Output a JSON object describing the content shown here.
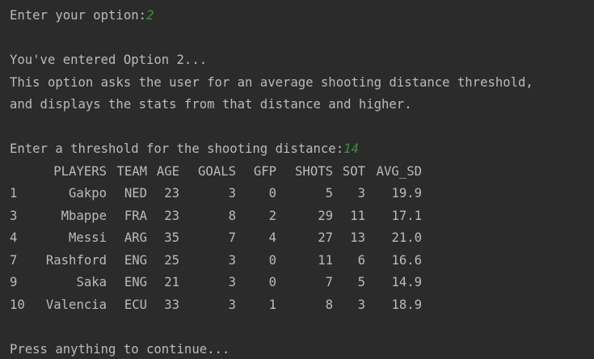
{
  "prompt": {
    "label": "Enter your option:",
    "value": "2"
  },
  "messages": {
    "entered": "You've entered Option 2...",
    "desc1": "This option asks the user for an average shooting distance threshold,",
    "desc2": "and displays the stats from that distance and higher."
  },
  "threshold_prompt": {
    "label": "Enter a threshold for the shooting distance:",
    "value": "14"
  },
  "table": {
    "headers": {
      "idx": "",
      "player": "PLAYERS",
      "team": "TEAM",
      "age": "AGE",
      "goals": "GOALS",
      "gfp": "GFP",
      "shots": "SHOTS",
      "sot": "SOT",
      "avg": "AVG_SD"
    },
    "rows": [
      {
        "idx": "1",
        "player": "Gakpo",
        "team": "NED",
        "age": "23",
        "goals": "3",
        "gfp": "0",
        "shots": "5",
        "sot": "3",
        "avg": "19.9"
      },
      {
        "idx": "3",
        "player": "Mbappe",
        "team": "FRA",
        "age": "23",
        "goals": "8",
        "gfp": "2",
        "shots": "29",
        "sot": "11",
        "avg": "17.1"
      },
      {
        "idx": "4",
        "player": "Messi",
        "team": "ARG",
        "age": "35",
        "goals": "7",
        "gfp": "4",
        "shots": "27",
        "sot": "13",
        "avg": "21.0"
      },
      {
        "idx": "7",
        "player": "Rashford",
        "team": "ENG",
        "age": "25",
        "goals": "3",
        "gfp": "0",
        "shots": "11",
        "sot": "6",
        "avg": "16.6"
      },
      {
        "idx": "9",
        "player": "Saka",
        "team": "ENG",
        "age": "21",
        "goals": "3",
        "gfp": "0",
        "shots": "7",
        "sot": "5",
        "avg": "14.9"
      },
      {
        "idx": "10",
        "player": "Valencia",
        "team": "ECU",
        "age": "33",
        "goals": "3",
        "gfp": "1",
        "shots": "8",
        "sot": "3",
        "avg": "18.9"
      }
    ]
  },
  "footer": {
    "press": "Press anything to continue..."
  },
  "colors": {
    "background": "#2b2b2b",
    "text": "#bbbbbb",
    "input_echo": "#3f8f3f"
  }
}
